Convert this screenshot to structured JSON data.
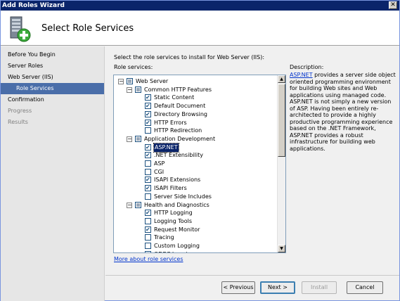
{
  "window": {
    "title": "Add Roles Wizard",
    "close_glyph": "✕"
  },
  "header": {
    "title": "Select Role Services",
    "icon": "server-add-icon"
  },
  "nav": {
    "items": [
      {
        "label": "Before You Begin",
        "state": "normal"
      },
      {
        "label": "Server Roles",
        "state": "normal"
      },
      {
        "label": "Web Server (IIS)",
        "state": "normal"
      },
      {
        "label": "Role Services",
        "state": "selected"
      },
      {
        "label": "Confirmation",
        "state": "normal"
      },
      {
        "label": "Progress",
        "state": "dim"
      },
      {
        "label": "Results",
        "state": "dim"
      }
    ]
  },
  "main": {
    "prompt": "Select the role services to install for Web Server (IIS):",
    "role_services_label": "Role services:",
    "description_label": "Description:",
    "description_link": "ASP.NET",
    "description_text": " provides a server side object oriented programming environment for building Web sites and Web applications using managed code. ASP.NET is not simply a new version of ASP. Having been entirely re-architected to provide a highly productive programming experience based on the .NET Framework, ASP.NET provides a robust infrastructure for building web applications.",
    "more_link": "More about role services"
  },
  "tree": [
    {
      "label": "Web Server",
      "level": 0,
      "expander": "−",
      "check": "partial"
    },
    {
      "label": "Common HTTP Features",
      "level": 1,
      "expander": "−",
      "check": "partial"
    },
    {
      "label": "Static Content",
      "level": 2,
      "check": "checked"
    },
    {
      "label": "Default Document",
      "level": 2,
      "check": "checked"
    },
    {
      "label": "Directory Browsing",
      "level": 2,
      "check": "checked"
    },
    {
      "label": "HTTP Errors",
      "level": 2,
      "check": "checked"
    },
    {
      "label": "HTTP Redirection",
      "level": 2,
      "check": "unchecked"
    },
    {
      "label": "Application Development",
      "level": 1,
      "expander": "−",
      "check": "partial"
    },
    {
      "label": "ASP.NET",
      "level": 2,
      "check": "checked",
      "selected": true
    },
    {
      "label": ".NET Extensibility",
      "level": 2,
      "check": "checked"
    },
    {
      "label": "ASP",
      "level": 2,
      "check": "unchecked"
    },
    {
      "label": "CGI",
      "level": 2,
      "check": "unchecked"
    },
    {
      "label": "ISAPI Extensions",
      "level": 2,
      "check": "checked"
    },
    {
      "label": "ISAPI Filters",
      "level": 2,
      "check": "checked"
    },
    {
      "label": "Server Side Includes",
      "level": 2,
      "check": "unchecked"
    },
    {
      "label": "Health and Diagnostics",
      "level": 1,
      "expander": "−",
      "check": "partial"
    },
    {
      "label": "HTTP Logging",
      "level": 2,
      "check": "checked"
    },
    {
      "label": "Logging Tools",
      "level": 2,
      "check": "unchecked"
    },
    {
      "label": "Request Monitor",
      "level": 2,
      "check": "checked"
    },
    {
      "label": "Tracing",
      "level": 2,
      "check": "unchecked"
    },
    {
      "label": "Custom Logging",
      "level": 2,
      "check": "unchecked"
    },
    {
      "label": "ODBC Logging",
      "level": 2,
      "check": "unchecked"
    }
  ],
  "scrollbar": {
    "up_glyph": "▲",
    "down_glyph": "▼"
  },
  "buttons": {
    "previous": "< Previous",
    "next": "Next >",
    "install": "Install",
    "cancel": "Cancel"
  },
  "colors": {
    "title_bar": "#0a246a",
    "selected_nav": "#4a6ea9",
    "link": "#0033cc"
  }
}
